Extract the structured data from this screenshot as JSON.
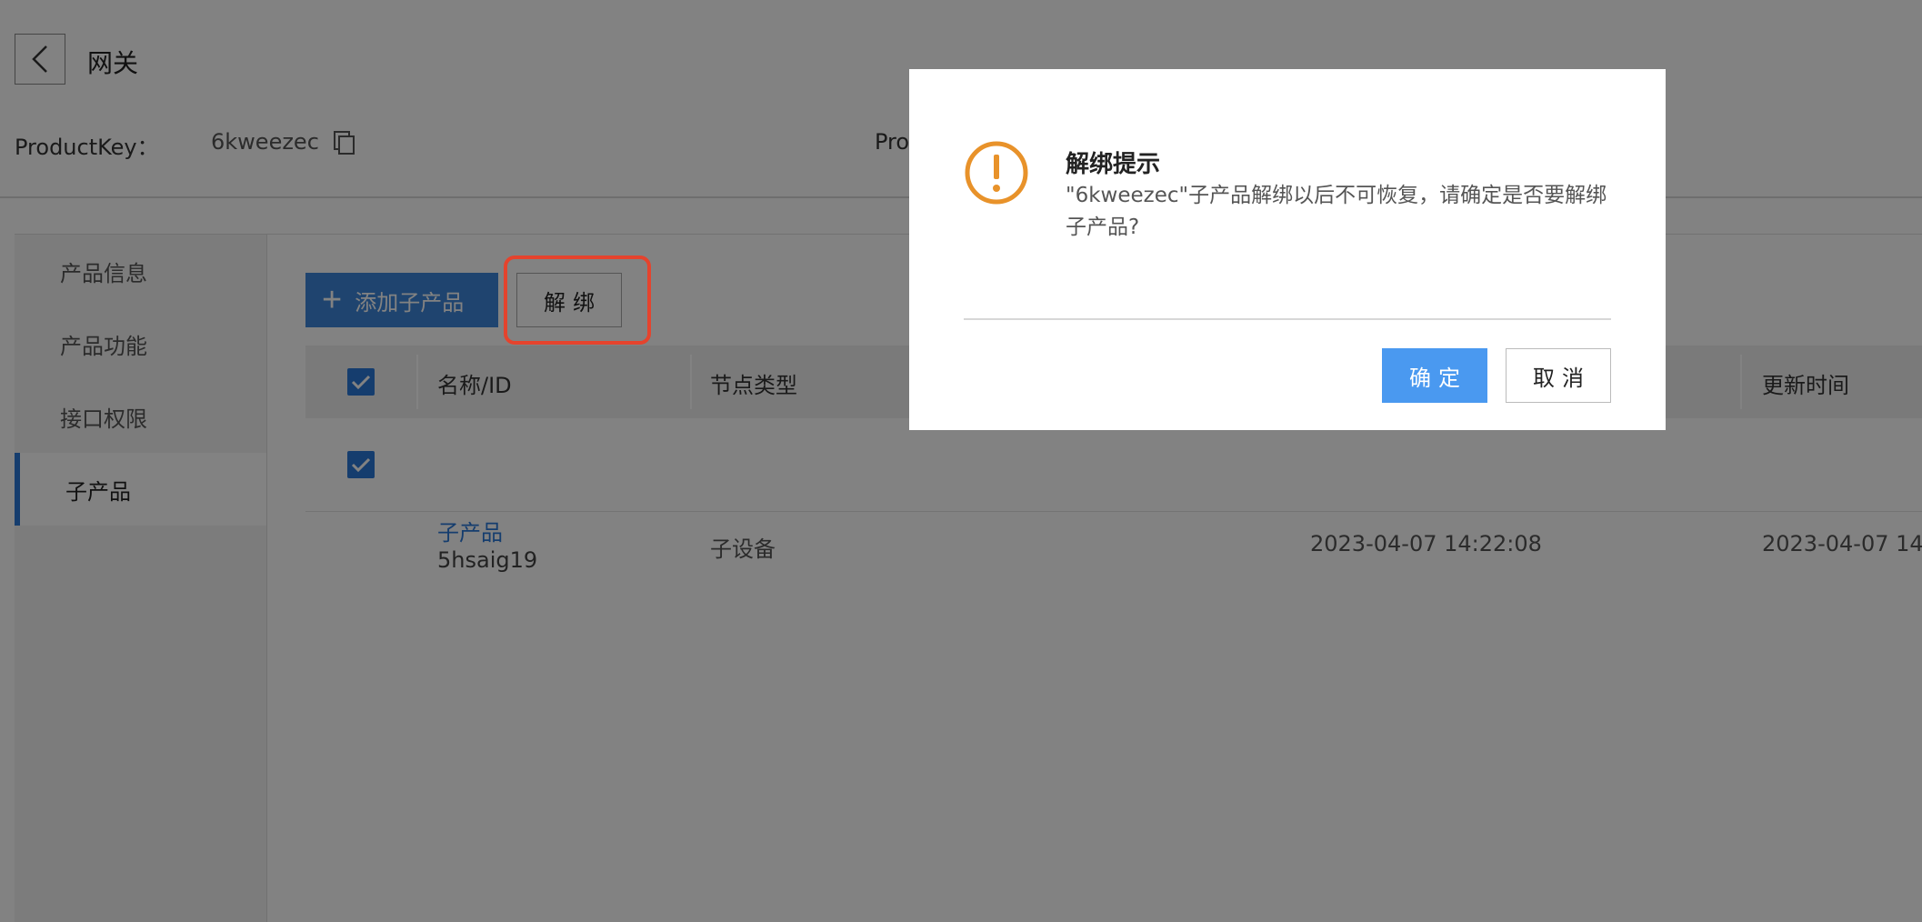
{
  "header": {
    "title": "网关",
    "product_key_label": "ProductKey：",
    "product_key_value": "6kweezec",
    "partial_label": "Pro"
  },
  "sidebar": {
    "items": [
      {
        "label": "产品信息",
        "active": false
      },
      {
        "label": "产品功能",
        "active": false
      },
      {
        "label": "接口权限",
        "active": false
      },
      {
        "label": "子产品",
        "active": true
      }
    ]
  },
  "toolbar": {
    "add_label": "添加子产品",
    "unbind_label": "解绑"
  },
  "table": {
    "columns": [
      "名称/ID",
      "节点类型",
      "更新时间"
    ],
    "rows": [
      {
        "checked": true,
        "name": "子产品",
        "id": "5hsaig19",
        "node_type": "子设备",
        "created_time": "2023-04-07 14:22:08",
        "updated_time": "2023-04-07 14"
      }
    ]
  },
  "modal": {
    "title": "解绑提示",
    "message": "\"6kweezec\"子产品解绑以后不可恢复，请确定是否要解绑子产品?",
    "confirm_label": "确定",
    "cancel_label": "取消"
  },
  "colors": {
    "primary": "#2a78d8",
    "confirm": "#4a99f0",
    "warning": "#e8922a",
    "highlight": "#e5432d",
    "overlay": "rgba(0,0,0,0.49)"
  }
}
